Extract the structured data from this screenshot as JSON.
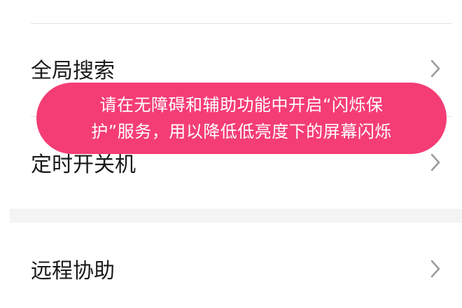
{
  "settings": {
    "items": [
      {
        "label": "全局搜索"
      },
      {
        "label": "定时开关机"
      },
      {
        "label": "远程协助"
      }
    ]
  },
  "toast": {
    "message": "请在无障碍和辅助功能中开启“闪烁保护”服务，用以降低低亮度下的屏幕闪烁"
  },
  "colors": {
    "toast_background": "#f53d75",
    "toast_text": "#ffffff",
    "label_text": "#1a1a1a",
    "chevron": "#9a9a9a",
    "divider": "#e4e4e4",
    "section_gap": "#f4f4f4"
  },
  "icons": {
    "chevron": "chevron-right-icon"
  }
}
